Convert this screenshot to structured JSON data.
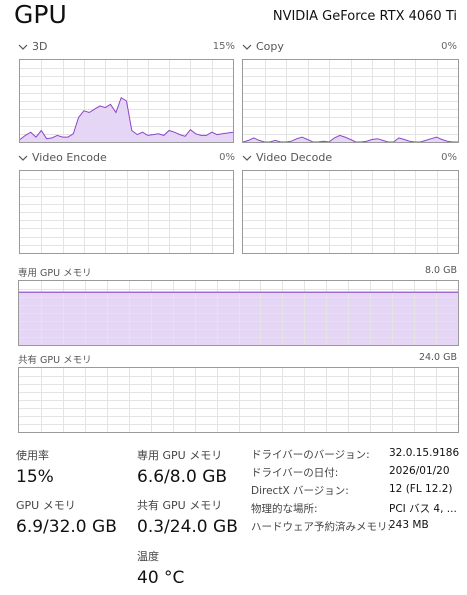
{
  "header": {
    "title": "GPU",
    "device_name": "NVIDIA GeForce RTX 4060 Ti"
  },
  "engines": [
    {
      "name": "3D",
      "percent": "15%",
      "series": [
        3,
        8,
        12,
        6,
        14,
        4,
        5,
        8,
        6,
        6,
        10,
        30,
        38,
        36,
        40,
        44,
        42,
        46,
        36,
        54,
        50,
        14,
        9,
        12,
        8,
        9,
        10,
        8,
        14,
        12,
        9,
        7,
        15,
        10,
        8,
        8,
        12,
        9,
        10,
        11,
        12
      ]
    },
    {
      "name": "Copy",
      "percent": "0%",
      "series": [
        0,
        2,
        5,
        2,
        0,
        0,
        2,
        0,
        0,
        1,
        4,
        6,
        3,
        0,
        0,
        1,
        0,
        5,
        8,
        6,
        3,
        0,
        0,
        1,
        3,
        4,
        2,
        0,
        0,
        5,
        3,
        1,
        0,
        0,
        2,
        4,
        6,
        3,
        1,
        0,
        0
      ]
    },
    {
      "name": "Video Encode",
      "percent": "0%",
      "series": []
    },
    {
      "name": "Video Decode",
      "percent": "0%",
      "series": []
    }
  ],
  "dedicated_memory": {
    "label": "専用 GPU メモリ",
    "max": "8.0 GB",
    "fill_fraction": 0.825
  },
  "shared_memory": {
    "label": "共有 GPU メモリ",
    "max": "24.0 GB",
    "fill_fraction": 0.0
  },
  "stats": {
    "utilization": {
      "label": "使用率",
      "value": "15%"
    },
    "dedicated": {
      "label": "専用 GPU メモリ",
      "value": "6.6/8.0 GB"
    },
    "gpu_memory": {
      "label": "GPU メモリ",
      "value": "6.9/32.0 GB"
    },
    "shared": {
      "label": "共有 GPU メモリ",
      "value": "0.3/24.0 GB"
    },
    "temperature": {
      "label": "温度",
      "value": "40 °C"
    }
  },
  "info": [
    {
      "key": "ドライバーのバージョン:",
      "value": "32.0.15.9186"
    },
    {
      "key": "ドライバーの日付:",
      "value": "2026/01/20"
    },
    {
      "key": "DirectX バージョン:",
      "value": "12 (FL 12.2)"
    },
    {
      "key": "物理的な場所:",
      "value": "PCI バス 4, ..."
    },
    {
      "key": "ハードウェア予約済みメモリ:",
      "value": "243 MB"
    }
  ],
  "colors": {
    "accent": "#8e44c8",
    "fill": "#e6d6f5",
    "grid": "#e4e4e4",
    "border": "#9a9a9a"
  }
}
